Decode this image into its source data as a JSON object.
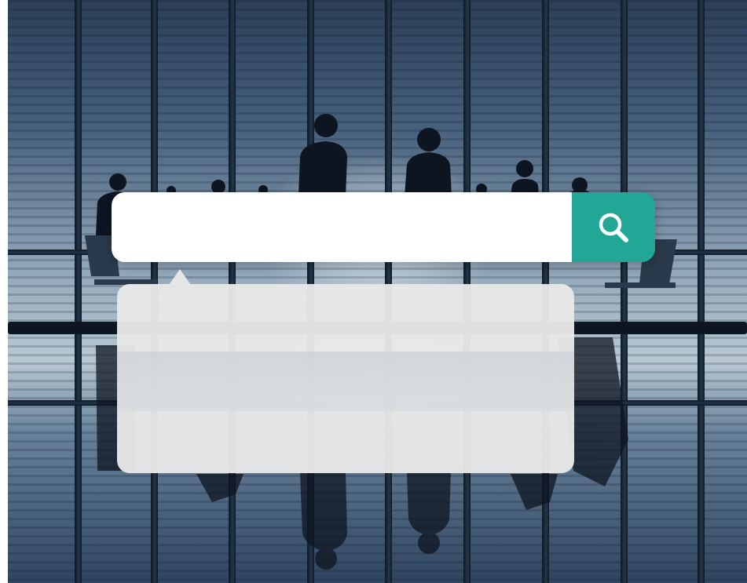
{
  "search": {
    "value": "",
    "placeholder": "",
    "button_icon": "search-icon",
    "accent_color": "#22a696"
  },
  "suggestions": {
    "items": []
  }
}
